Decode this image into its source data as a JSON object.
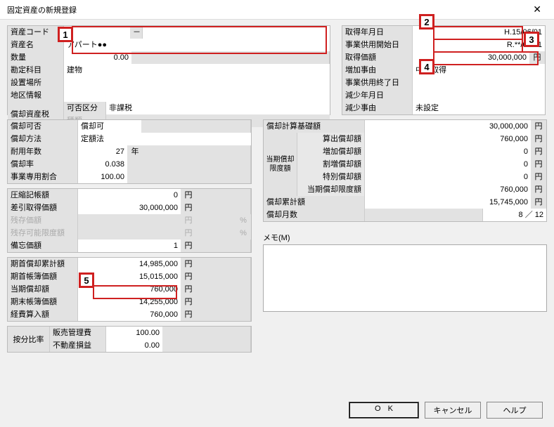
{
  "title": "固定資産の新規登録",
  "markers": {
    "m1": "1",
    "m2": "2",
    "m3": "3",
    "m4": "4",
    "m5": "5"
  },
  "left1": {
    "code_lbl": "資産コード",
    "code_sep": "－",
    "name_lbl": "資産名",
    "name_val": "アパート●●",
    "qty_lbl": "数量",
    "qty_val": "0.00",
    "acct_lbl": "勘定科目",
    "acct_val": "建物",
    "place_lbl": "設置場所",
    "region_lbl": "地区情報",
    "tax_lbl": "償却資産税",
    "tax_sub1_lbl": "可否区分",
    "tax_sub1_val": "非課税",
    "tax_sub2_lbl": "種類"
  },
  "right1": {
    "acq_date_lbl": "取得年月日",
    "acq_date_val": "H.15/06/01",
    "use_start_lbl": "事業供用開始日",
    "use_start_val": "R.**/05/01",
    "acq_amt_lbl": "取得価額",
    "acq_amt_val": "30,000,000",
    "yen": "円",
    "inc_reason_lbl": "増加事由",
    "inc_reason_val": "中古取得",
    "use_end_lbl": "事業供用終了日",
    "dec_date_lbl": "減少年月日",
    "dec_reason_lbl": "減少事由",
    "dec_reason_val": "未設定"
  },
  "left2": {
    "dep_ok_lbl": "償却可否",
    "dep_ok_val": "償却可",
    "method_lbl": "償却方法",
    "method_val": "定額法",
    "life_lbl": "耐用年数",
    "life_val": "27",
    "life_unit": "年",
    "rate_lbl": "償却率",
    "rate_val": "0.038",
    "biz_pct_lbl": "事業専用割合",
    "biz_pct_val": "100.00"
  },
  "right2": {
    "base_lbl": "償却計算基礎額",
    "base_val": "30,000,000",
    "period_lbl1": "当期償却",
    "period_lbl2": "限度額",
    "calc_lbl": "算出償却額",
    "calc_val": "760,000",
    "add_lbl": "増加償却額",
    "add_val": "0",
    "split_lbl": "割増償却額",
    "split_val": "0",
    "spec_lbl": "特別償却額",
    "spec_val": "0",
    "limit_lbl": "当期償却限度額",
    "limit_val": "760,000",
    "accum_lbl": "償却累計額",
    "accum_val": "15,745,000",
    "months_lbl": "償却月数",
    "months_val": "8 ／ 12",
    "yen": "円"
  },
  "left3": {
    "comp_lbl": "圧縮記帳額",
    "comp_val": "0",
    "diff_lbl": "差引取得価額",
    "diff_val": "30,000,000",
    "resid_lbl": "残存価額",
    "residlim_lbl": "残存可能限度額",
    "memo_lbl": "備忘価額",
    "memo_val": "1",
    "pct": "%",
    "yen": "円"
  },
  "left4": {
    "opening_accum_lbl": "期首償却累計額",
    "opening_accum_val": "14,985,000",
    "opening_book_lbl": "期首帳簿価額",
    "opening_book_val": "15,015,000",
    "curr_dep_lbl": "当期償却額",
    "curr_dep_val": "760,000",
    "end_book_lbl": "期末帳簿価額",
    "end_book_val": "14,255,000",
    "exp_lbl": "経費算入額",
    "exp_val": "760,000",
    "yen": "円"
  },
  "left5": {
    "ratio_lbl": "按分比率",
    "sga_lbl": "販売管理費",
    "sga_val": "100.00",
    "re_lbl": "不動産損益",
    "re_val": "0.00"
  },
  "memo_label": "メモ(M)",
  "buttons": {
    "ok": "OK",
    "cancel": "キャンセル",
    "help": "ヘルプ"
  }
}
